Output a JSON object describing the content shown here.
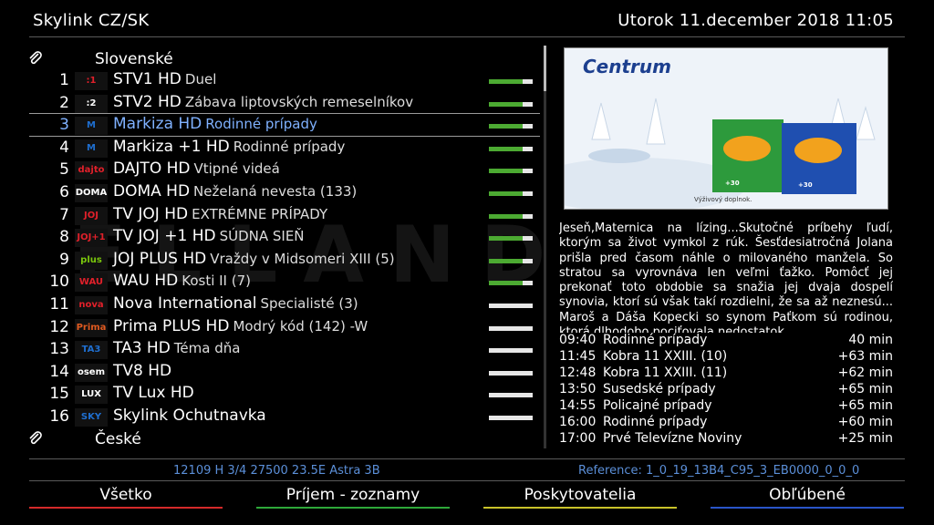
{
  "header": {
    "provider": "Skylink CZ/SK",
    "datetime": "Utorok  11.december 2018   11:05"
  },
  "groups": {
    "top": "Slovenské",
    "bottom": "České"
  },
  "watermark": "ELLAND",
  "channels": [
    {
      "num": "1",
      "logo": ":1",
      "logo_color": "#e0202a",
      "name": "STV1 HD",
      "event": "Duel",
      "signal": 0.78
    },
    {
      "num": "2",
      "logo": ":2",
      "logo_color": "#ffffff",
      "name": "STV2 HD",
      "event": "Zábava liptovských remeselníkov",
      "signal": 0.78
    },
    {
      "num": "3",
      "logo": "M",
      "logo_color": "#1f6fd0",
      "name": "Markiza HD",
      "event": "Rodinné prípady",
      "signal": 0.78,
      "selected": true
    },
    {
      "num": "4",
      "logo": "M",
      "logo_color": "#1f6fd0",
      "name": "Markiza +1 HD",
      "event": "Rodinné prípady",
      "signal": 0.78
    },
    {
      "num": "5",
      "logo": "dajto",
      "logo_color": "#e0202a",
      "name": "DAJTO HD",
      "event": "Vtipné videá",
      "signal": 0.78
    },
    {
      "num": "6",
      "logo": "DOMA",
      "logo_color": "#ffffff",
      "name": "DOMA HD",
      "event": "Neželaná nevesta (133)",
      "signal": 0.78
    },
    {
      "num": "7",
      "logo": "JOJ",
      "logo_color": "#e0202a",
      "name": "TV JOJ HD",
      "event": "EXTRÉMNE PRÍPADY",
      "signal": 0.78
    },
    {
      "num": "8",
      "logo": "JOJ+1",
      "logo_color": "#e0202a",
      "name": "TV JOJ +1 HD",
      "event": "SÚDNA SIEŇ",
      "signal": 0.78
    },
    {
      "num": "9",
      "logo": "plus",
      "logo_color": "#7ac70c",
      "name": "JOJ PLUS HD",
      "event": "Vraždy v Midsomeri XIII (5)",
      "signal": 0.78
    },
    {
      "num": "10",
      "logo": "WAU",
      "logo_color": "#e0202a",
      "name": "WAU HD",
      "event": "Kosti II (7)",
      "signal": 0.78
    },
    {
      "num": "11",
      "logo": "nova",
      "logo_color": "#e0202a",
      "name": "Nova International",
      "event": "Specialisté (3)",
      "signal": 0.0
    },
    {
      "num": "12",
      "logo": "Prima",
      "logo_color": "#e05a20",
      "name": "Prima PLUS HD",
      "event": "Modrý kód (142) -W",
      "signal": 0.0
    },
    {
      "num": "13",
      "logo": "TA3",
      "logo_color": "#1f6fd0",
      "name": "TA3 HD",
      "event": "Téma dňa",
      "signal": 0.0
    },
    {
      "num": "14",
      "logo": "osem",
      "logo_color": "#ffffff",
      "name": "TV8 HD",
      "event": "",
      "signal": 0.0
    },
    {
      "num": "15",
      "logo": "LUX",
      "logo_color": "#ffffff",
      "name": "TV Lux HD",
      "event": "",
      "signal": 0.0
    },
    {
      "num": "16",
      "logo": "SKY",
      "logo_color": "#1f6fd0",
      "name": "Skylink Ochutnavka",
      "event": "",
      "signal": 0.0
    }
  ],
  "poster": {
    "brand": "Centrum",
    "caption": "Výživový doplnok.",
    "badge1": "+30",
    "badge2": "+30"
  },
  "description": "Jeseň,Maternica na lízing...Skutočné príbehy ľudí, ktorým sa život vymkol z rúk. Šesťdesiatročná Jolana prišla pred časom náhle o milovaného manžela. So stratou sa vyrovnáva len veľmi ťažko. Pomôcť jej prekonať toto obdobie sa snažia jej dvaja dospelí synovia, ktorí sú však takí rozdielni, že sa až neznesú... Maroš a Dáša Kopecki so synom Paťkom sú rodinou, ktorá dlhodobo pociťovala nedostatok",
  "epg": [
    {
      "time": "09:40",
      "title": "Rodinné prípady",
      "dur": "40 min"
    },
    {
      "time": "11:45",
      "title": "Kobra 11 XXIII. (10)",
      "dur": "+63 min"
    },
    {
      "time": "12:48",
      "title": "Kobra 11 XXIII. (11)",
      "dur": "+62 min"
    },
    {
      "time": "13:50",
      "title": "Susedské prípady",
      "dur": "+65 min"
    },
    {
      "time": "14:55",
      "title": "Policajné prípady",
      "dur": "+65 min"
    },
    {
      "time": "16:00",
      "title": "Rodinné prípady",
      "dur": "+60 min"
    },
    {
      "time": "17:00",
      "title": "Prvé Televízne Noviny",
      "dur": "+25 min"
    }
  ],
  "info": {
    "transponder": "12109 H  3/4  27500  23.5E Astra 3B",
    "reference": "Reference: 1_0_19_13B4_C95_3_EB0000_0_0_0"
  },
  "buttons": [
    {
      "label": "Všetko",
      "color": "#d42a2a"
    },
    {
      "label": "Príjem - zoznamy",
      "color": "#2ea83a"
    },
    {
      "label": "Poskytovatelia",
      "color": "#c9c22a"
    },
    {
      "label": "Obľúbené",
      "color": "#2a55c9"
    }
  ]
}
